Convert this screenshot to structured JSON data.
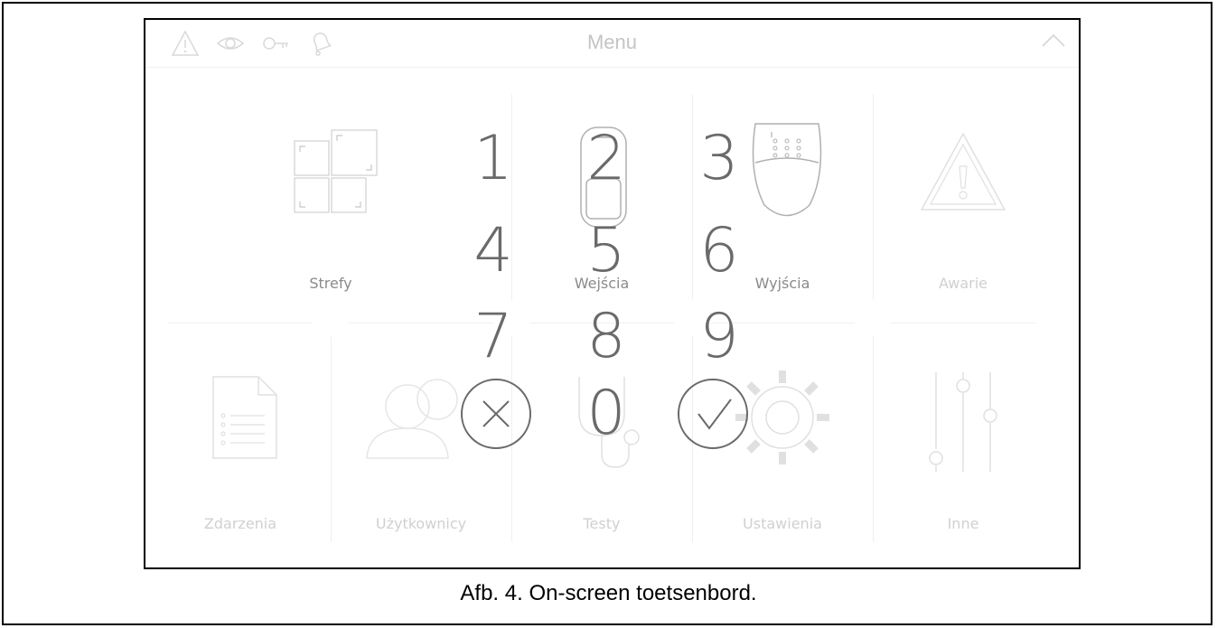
{
  "header": {
    "title": "Menu"
  },
  "tiles": [
    {
      "label": "Strefy",
      "icon": "zones-icon"
    },
    {
      "label": "Wejścia",
      "icon": "inputs-icon"
    },
    {
      "label": "Wyjścia",
      "icon": "outputs-icon"
    },
    {
      "label": "Awarie",
      "icon": "warning-icon"
    },
    {
      "label": "Zdarzenia",
      "icon": "events-icon"
    },
    {
      "label": "Użytkownicy",
      "icon": "users-icon"
    },
    {
      "label": "Testy",
      "icon": "stethoscope-icon"
    },
    {
      "label": "Ustawienia",
      "icon": "gear-icon"
    },
    {
      "label": "Inne",
      "icon": "sliders-icon"
    }
  ],
  "keypad": {
    "keys": [
      "1",
      "2",
      "3",
      "4",
      "5",
      "6",
      "7",
      "8",
      "9",
      "0"
    ],
    "cancel_icon": "cancel-icon",
    "confirm_icon": "confirm-icon"
  },
  "status_icons": [
    "alarm-icon",
    "eye-icon",
    "key-icon",
    "bell-icon"
  ],
  "caption": "Afb. 4. On-screen toetsenbord.",
  "colors": {
    "keypad": "#6a6a6a",
    "faded_icon": "#d9d9d9",
    "label": "#c0c0c0"
  }
}
